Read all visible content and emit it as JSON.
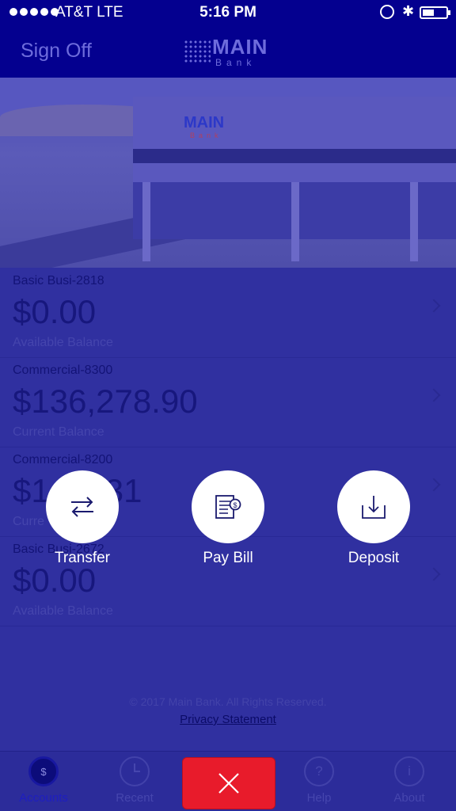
{
  "status_bar": {
    "carrier": "AT&T  LTE",
    "time": "5:16 PM"
  },
  "nav": {
    "sign_off": "Sign Off",
    "logo_main": "MAIN",
    "logo_sub": "Bank"
  },
  "hero": {
    "sign_main": "MAIN",
    "sign_sub": "Bank"
  },
  "accounts": [
    {
      "name": "Basic Busi-2818",
      "amount": "$0.00",
      "label": "Available Balance"
    },
    {
      "name": "Commercial-8300",
      "amount": "$136,278.90",
      "label": "Current Balance"
    },
    {
      "name": "Commercial-8200",
      "amount": "$1  03.31",
      "label": "Curre"
    },
    {
      "name": "Basic Busi-2672",
      "amount": "$0.00",
      "label": "Available Balance"
    }
  ],
  "footer": {
    "copyright": "© 2017 Main Bank. All Rights Reserved.",
    "privacy": "Privacy Statement"
  },
  "actions": [
    {
      "label": "Transfer",
      "icon": "transfer-arrows-icon"
    },
    {
      "label": "Pay Bill",
      "icon": "bill-icon"
    },
    {
      "label": "Deposit",
      "icon": "deposit-tray-icon"
    }
  ],
  "tabs": [
    {
      "label": "Accounts",
      "icon": "dollar-icon",
      "glyph": "$",
      "active": true
    },
    {
      "label": "Recent",
      "icon": "clock-icon",
      "glyph": "",
      "active": false
    },
    {
      "label": "Help",
      "icon": "question-icon",
      "glyph": "?",
      "active": false
    },
    {
      "label": "About",
      "icon": "info-icon",
      "glyph": "i",
      "active": false
    }
  ],
  "colors": {
    "header": "#04008f",
    "overlay": "#3232a0",
    "close_button": "#e81b2b"
  }
}
